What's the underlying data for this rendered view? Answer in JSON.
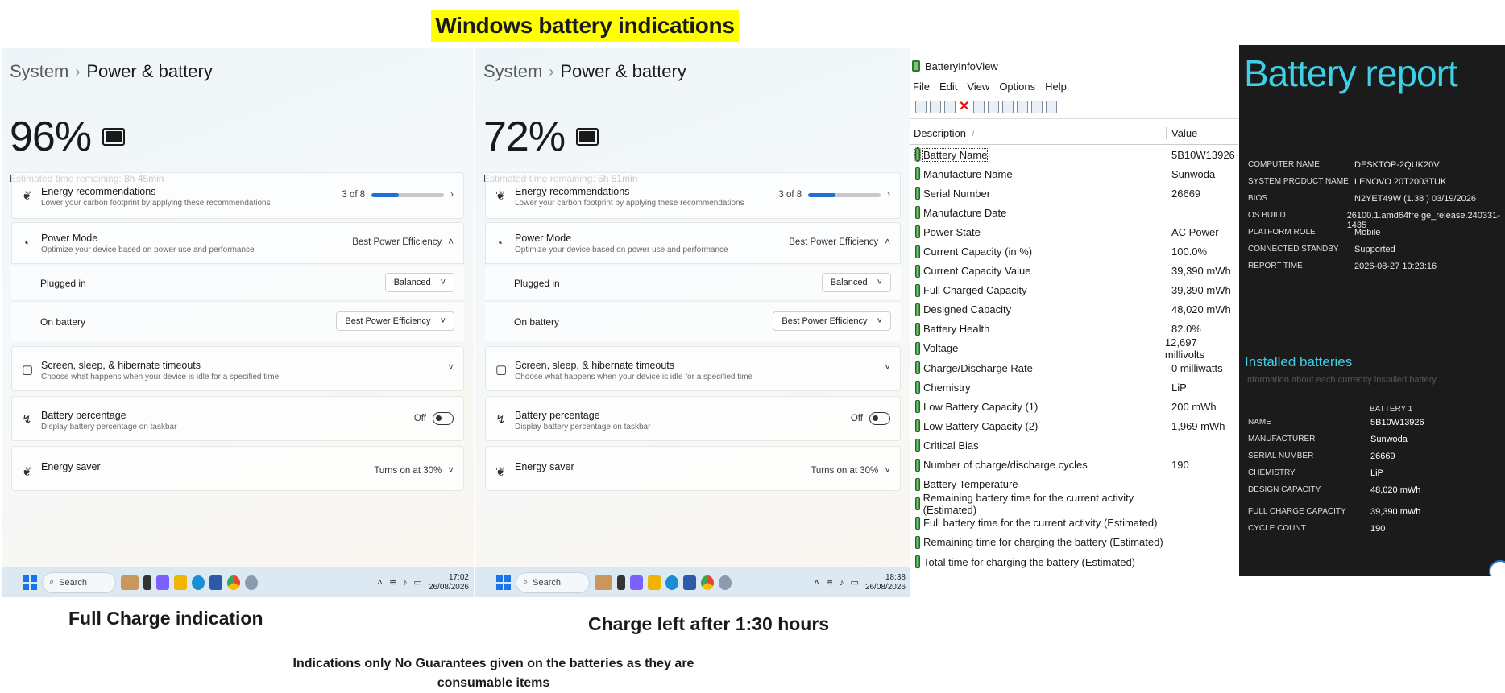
{
  "banner": "Windows battery indications",
  "captions": {
    "left": "Full Charge indication",
    "middle": "Charge left after 1:30 hours",
    "disclaimer": "Indications only No Guarantees given on the batteries as they are consumable items"
  },
  "panels": [
    {
      "breadcrumb_system": "System",
      "breadcrumb_page": "Power & battery",
      "percent": "96%",
      "est_label": "Estimated time remaining:",
      "est_value": "8h 45min",
      "energy_title": "Energy recommendations",
      "energy_sub": "Lower your carbon footprint by applying these recommendations",
      "energy_count": "3 of 8",
      "energy_progress": 0.375,
      "power_mode_title": "Power Mode",
      "power_mode_sub": "Optimize your device based on power use and performance",
      "power_mode_value": "Best Power Efficiency",
      "plugged_label": "Plugged in",
      "plugged_value": "Balanced",
      "onbattery_label": "On battery",
      "onbattery_value": "Best Power Efficiency",
      "screen_title": "Screen, sleep, & hibernate timeouts",
      "screen_sub": "Choose what happens when your device is idle for a specified time",
      "batpct_title": "Battery percentage",
      "batpct_sub": "Display battery percentage on taskbar",
      "batpct_state": "Off",
      "saver_title": "Energy saver",
      "saver_value": "Turns on at 30%",
      "search": "Search",
      "time": "17:02",
      "date": "26/08/2026"
    },
    {
      "breadcrumb_system": "System",
      "breadcrumb_page": "Power & battery",
      "percent": "72%",
      "est_label": "Estimated time remaining:",
      "est_value": "5h 51min",
      "energy_title": "Energy recommendations",
      "energy_sub": "Lower your carbon footprint by applying these recommendations",
      "energy_count": "3 of 8",
      "energy_progress": 0.375,
      "power_mode_title": "Power Mode",
      "power_mode_sub": "Optimize your device based on power use and performance",
      "power_mode_value": "Best Power Efficiency",
      "plugged_label": "Plugged in",
      "plugged_value": "Balanced",
      "onbattery_label": "On battery",
      "onbattery_value": "Best Power Efficiency",
      "screen_title": "Screen, sleep, & hibernate timeouts",
      "screen_sub": "Choose what happens when your device is idle for a specified time",
      "batpct_title": "Battery percentage",
      "batpct_sub": "Display battery percentage on taskbar",
      "batpct_state": "Off",
      "saver_title": "Energy saver",
      "saver_value": "Turns on at 30%",
      "search": "Search",
      "time": "18:38",
      "date": "26/08/2026"
    }
  ],
  "biv": {
    "title": "BatteryInfoView",
    "menu": [
      "File",
      "Edit",
      "View",
      "Options",
      "Help"
    ],
    "col_desc": "Description",
    "col_desc_sort": "/",
    "col_value": "Value",
    "rows": [
      {
        "d": "Battery Name",
        "v": "5B10W13926"
      },
      {
        "d": "Manufacture Name",
        "v": "Sunwoda"
      },
      {
        "d": "Serial Number",
        "v": "26669"
      },
      {
        "d": "Manufacture Date",
        "v": ""
      },
      {
        "d": "Power State",
        "v": "AC Power"
      },
      {
        "d": "Current Capacity (in %)",
        "v": "100.0%"
      },
      {
        "d": "Current Capacity Value",
        "v": "39,390 mWh"
      },
      {
        "d": "Full Charged Capacity",
        "v": "39,390 mWh"
      },
      {
        "d": "Designed Capacity",
        "v": "48,020 mWh"
      },
      {
        "d": "Battery Health",
        "v": "82.0%"
      },
      {
        "d": "Voltage",
        "v": "12,697 millivolts"
      },
      {
        "d": "Charge/Discharge Rate",
        "v": "0 milliwatts"
      },
      {
        "d": "Chemistry",
        "v": "LiP"
      },
      {
        "d": "Low Battery Capacity (1)",
        "v": "200 mWh"
      },
      {
        "d": "Low Battery Capacity (2)",
        "v": "1,969 mWh"
      },
      {
        "d": "Critical Bias",
        "v": ""
      },
      {
        "d": "Number of charge/discharge cycles",
        "v": "190"
      },
      {
        "d": "Battery Temperature",
        "v": ""
      },
      {
        "d": "Remaining battery time for the current activity (Estimated)",
        "v": ""
      },
      {
        "d": "Full battery time for the current activity (Estimated)",
        "v": ""
      },
      {
        "d": "Remaining time for charging the battery (Estimated)",
        "v": ""
      },
      {
        "d": "Total  time for charging the battery (Estimated)",
        "v": ""
      }
    ]
  },
  "report": {
    "title": "Battery report",
    "system": [
      {
        "k": "COMPUTER NAME",
        "v": "DESKTOP-2QUK20V"
      },
      {
        "k": "SYSTEM PRODUCT NAME",
        "v": "LENOVO 20T2003TUK"
      },
      {
        "k": "BIOS",
        "v": "N2YET49W (1.38 ) 03/19/2026"
      },
      {
        "k": "OS BUILD",
        "v": "26100.1.amd64fre.ge_release.240331-1435"
      },
      {
        "k": "PLATFORM ROLE",
        "v": "Mobile"
      },
      {
        "k": "CONNECTED STANDBY",
        "v": "Supported"
      },
      {
        "k": "REPORT TIME",
        "v": "2026-08-27  10:23:16"
      }
    ],
    "installed_title": "Installed batteries",
    "installed_info": "Information about each currently installed battery",
    "battery_header": "BATTERY 1",
    "battery": [
      {
        "k": "NAME",
        "v": "5B10W13926"
      },
      {
        "k": "MANUFACTURER",
        "v": "Sunwoda"
      },
      {
        "k": "SERIAL NUMBER",
        "v": "26669"
      },
      {
        "k": "CHEMISTRY",
        "v": "LiP"
      },
      {
        "k": "DESIGN CAPACITY",
        "v": "48,020 mWh"
      },
      {
        "k": "FULL CHARGE CAPACITY",
        "v": "39,390 mWh"
      },
      {
        "k": "CYCLE COUNT",
        "v": "190"
      }
    ]
  }
}
